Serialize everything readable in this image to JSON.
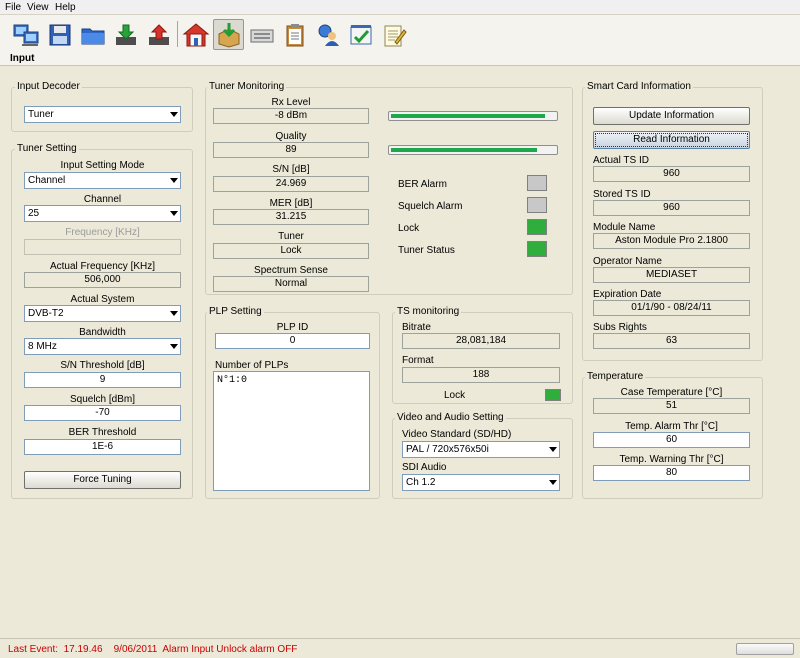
{
  "menu": {
    "items": [
      "File",
      "View",
      "Help"
    ]
  },
  "toolbar": {
    "label": "Input",
    "icons": [
      "computer-icon",
      "save-icon",
      "folder-icon",
      "download-icon",
      "upload-icon",
      "home-icon",
      "input-box-icon",
      "device-icon",
      "clipboard-icon",
      "user-globe-icon",
      "checklist-icon",
      "notepad-icon"
    ]
  },
  "input_decoder": {
    "title": "Input Decoder",
    "selected": "Tuner"
  },
  "tuner_setting": {
    "title": "Tuner Setting",
    "input_setting_mode_label": "Input Setting Mode",
    "input_setting_mode": "Channel",
    "channel_label": "Channel",
    "channel": "25",
    "frequency_label": "Frequency [KHz]",
    "frequency": "",
    "actual_frequency_label": "Actual Frequency [KHz]",
    "actual_frequency": "506,000",
    "actual_system_label": "Actual System",
    "actual_system": "DVB-T2",
    "bandwidth_label": "Bandwidth",
    "bandwidth": "8 MHz",
    "sn_threshold_label": "S/N Threshold [dB]",
    "sn_threshold": "9",
    "squelch_label": "Squelch [dBm]",
    "squelch": "-70",
    "ber_threshold_label": "BER Threshold",
    "ber_threshold": "1E-6",
    "force_tuning_label": "Force Tuning"
  },
  "tuner_monitoring": {
    "title": "Tuner Monitoring",
    "rx_level_label": "Rx Level",
    "rx_level": "-8 dBm",
    "rx_level_fraction": 0.94,
    "quality_label": "Quality",
    "quality": "89",
    "quality_fraction": 0.89,
    "sn_label": "S/N [dB]",
    "sn": "24.969",
    "mer_label": "MER [dB]",
    "mer": "31.215",
    "tuner_label": "Tuner",
    "tuner": "Lock",
    "spectrum_sense_label": "Spectrum Sense",
    "spectrum_sense": "Normal",
    "ber_alarm_label": "BER Alarm",
    "squelch_alarm_label": "Squelch Alarm",
    "lock_label": "Lock",
    "tuner_status_label": "Tuner Status",
    "colors": {
      "off": "#c8c8c8",
      "on": "#2fae3e"
    }
  },
  "plp_setting": {
    "title": "PLP Setting",
    "plp_id_label": "PLP ID",
    "plp_id": "0",
    "number_of_plps_label": "Number of PLPs",
    "plps_text": "N°1:0"
  },
  "ts_monitoring": {
    "title": "TS monitoring",
    "bitrate_label": "Bitrate",
    "bitrate": "28,081,184",
    "format_label": "Format",
    "format": "188",
    "lock_label": "Lock"
  },
  "video_audio": {
    "title": "Video and Audio Setting",
    "video_standard_label": "Video Standard (SD/HD)",
    "video_standard": "PAL / 720x576x50i",
    "sdi_audio_label": "SDI Audio",
    "sdi_audio": "Ch 1.2"
  },
  "smart_card": {
    "title": "Smart Card Information",
    "update_label": "Update Information",
    "read_label": "Read Information",
    "actual_ts_id_label": "Actual TS ID",
    "actual_ts_id": "960",
    "stored_ts_id_label": "Stored TS ID",
    "stored_ts_id": "960",
    "module_name_label": "Module Name",
    "module_name": "Aston Module Pro 2.1800",
    "operator_name_label": "Operator Name",
    "operator_name": "MEDIASET",
    "expiration_date_label": "Expiration Date",
    "expiration_date": "01/1/90 - 08/24/11",
    "subs_rights_label": "Subs Rights",
    "subs_rights": "63"
  },
  "temperature": {
    "title": "Temperature",
    "case_label": "Case Temperature [°C]",
    "case": "51",
    "alarm_label": "Temp. Alarm Thr [°C]",
    "alarm": "60",
    "warning_label": "Temp. Warning Thr [°C]",
    "warning": "80"
  },
  "status": {
    "text": "Last Event:  17.19.46    9/06/2011  Alarm Input Unlock alarm OFF"
  }
}
